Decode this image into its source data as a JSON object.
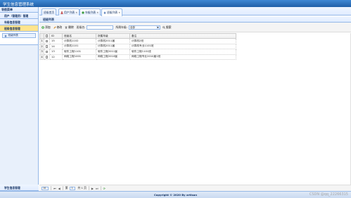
{
  "app": {
    "title": "学生信息管理系统"
  },
  "sidebar": {
    "header": "导航菜单",
    "panels": [
      {
        "label": "用户（管理员）管理"
      },
      {
        "label": "年级信息管理"
      },
      {
        "label": "班级信息管理",
        "active": true
      }
    ],
    "active_item": "班级列表",
    "bottom_panel": "学生信息管理"
  },
  "tabs": [
    {
      "label": "班级首页",
      "closable": false
    },
    {
      "label": "用户列表",
      "closable": true
    },
    {
      "label": "年级列表",
      "closable": true
    },
    {
      "label": "班级列表",
      "closable": true,
      "selected": true
    }
  ],
  "grid": {
    "title": "班级列表",
    "toolbar": {
      "add": "添加",
      "edit": "修改",
      "delete": "删除",
      "search_label": "班级名:",
      "search_value": "",
      "grade_label": "所属年级:",
      "grade_value": "全部",
      "search_button": "搜索"
    },
    "columns": [
      "ID",
      "班级名",
      "所属年级",
      "备注"
    ],
    "rows": [
      {
        "num": "1",
        "id": "15",
        "name": "计算机1102",
        "grade": "计算机2011届",
        "remark": "计算机2班"
      },
      {
        "num": "2",
        "id": "14",
        "name": "计算机1101",
        "grade": "计算机2011届",
        "remark": "计算机专业1101班"
      },
      {
        "num": "3",
        "id": "13",
        "name": "软件工程1101",
        "grade": "软件工程2011届",
        "remark": "软件工程1101班"
      },
      {
        "num": "4",
        "id": "12",
        "name": "网络工程1001",
        "grade": "网络工程2010届",
        "remark": "网络工程专业2010届1班"
      }
    ]
  },
  "pager": {
    "page_size": "10",
    "page_label": "第",
    "page_value": "1",
    "total_label": "共 1 页"
  },
  "footer": {
    "copyright": "Copyright © 2020 By artisan"
  },
  "watermark": "CSDN @qq_22266315",
  "colors": {
    "header": "#1f5fa8",
    "border": "#95b8e7",
    "active_panel": "#ffe48d"
  }
}
